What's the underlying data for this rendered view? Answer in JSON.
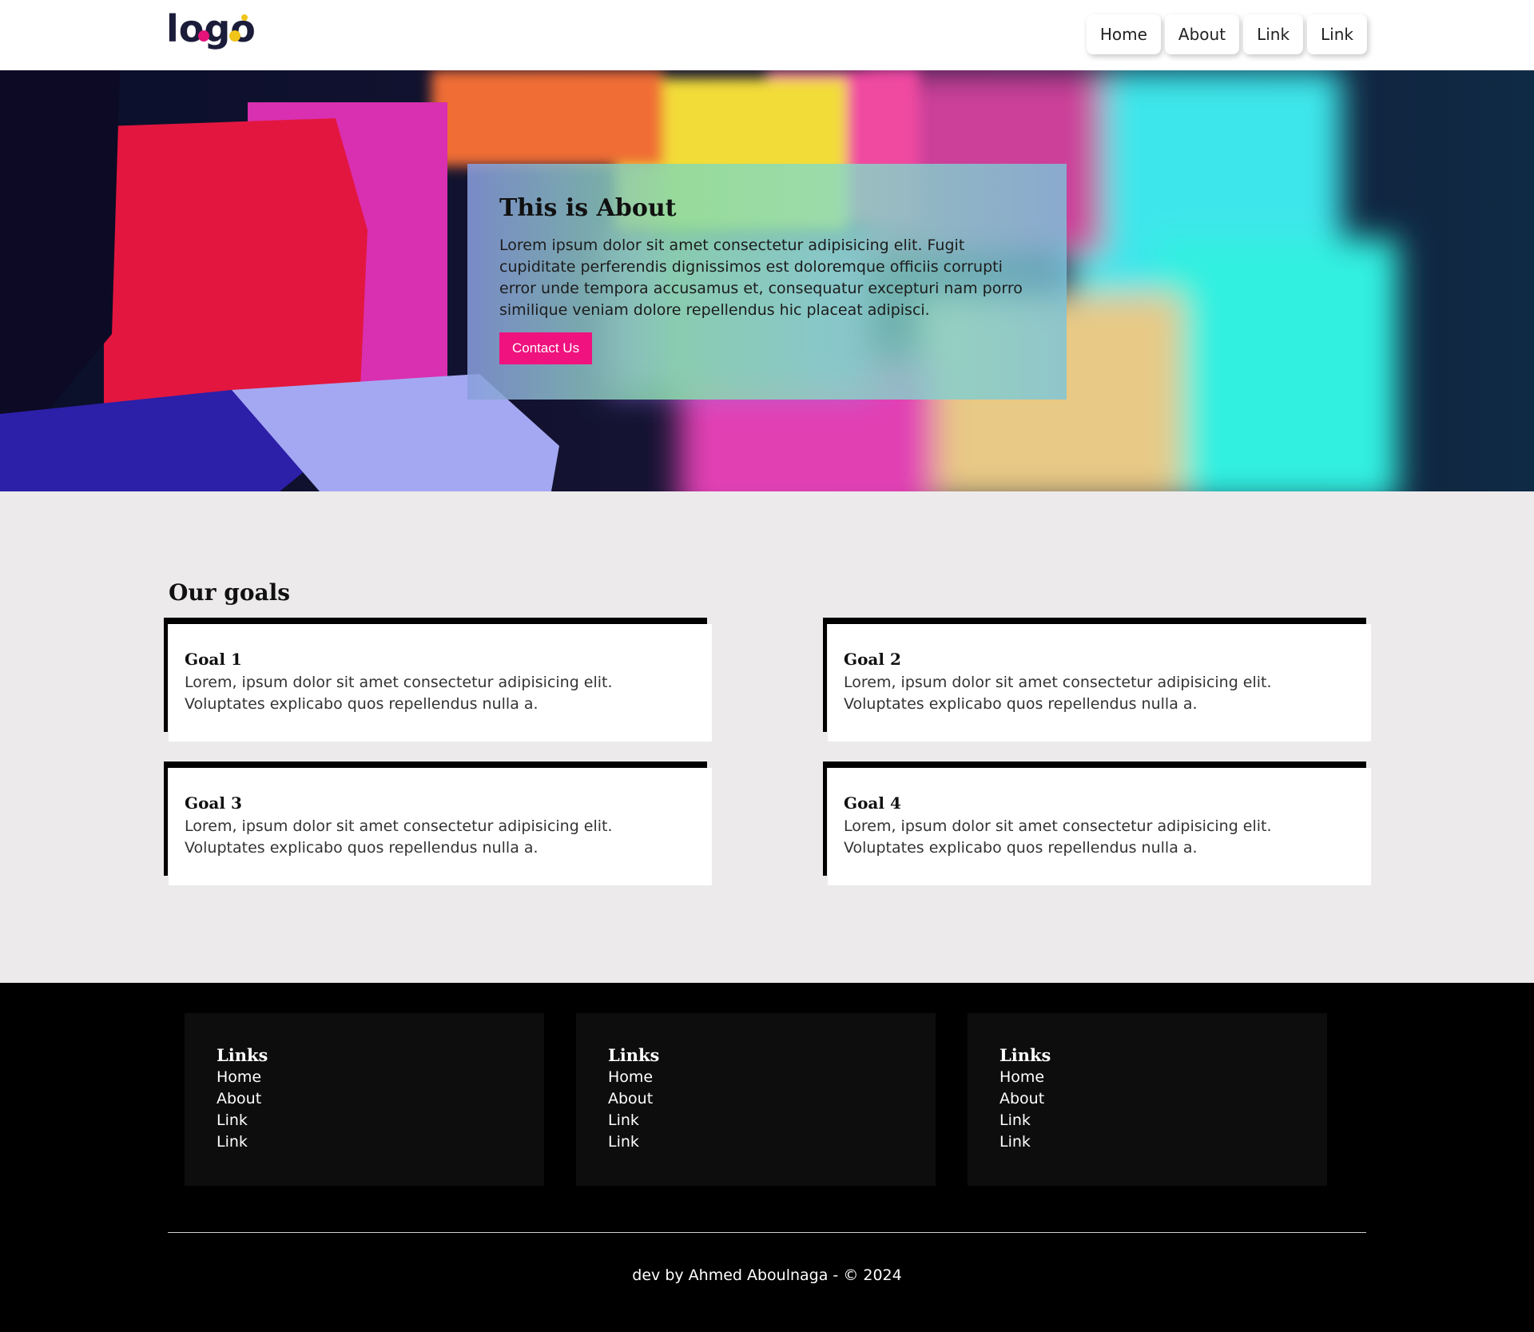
{
  "header": {
    "logo_text": "logo",
    "nav": [
      "Home",
      "About",
      "Link",
      "Link"
    ]
  },
  "hero": {
    "title": "This is About",
    "text": "Lorem ipsum dolor sit amet consectetur adipisicing elit. Fugit cupiditate perferendis dignissimos est doloremque officiis corrupti error unde tempora accusamus et, consequatur excepturi nam porro similique veniam dolore repellendus hic placeat adipisci.",
    "button": "Contact Us"
  },
  "goals": {
    "title": "Our goals",
    "items": [
      {
        "title": "Goal 1",
        "text": "Lorem, ipsum dolor sit amet consectetur adipisicing elit. Voluptates explicabo quos repellendus nulla a."
      },
      {
        "title": "Goal 2",
        "text": "Lorem, ipsum dolor sit amet consectetur adipisicing elit. Voluptates explicabo quos repellendus nulla a."
      },
      {
        "title": "Goal 3",
        "text": "Lorem, ipsum dolor sit amet consectetur adipisicing elit. Voluptates explicabo quos repellendus nulla a."
      },
      {
        "title": "Goal 4",
        "text": "Lorem, ipsum dolor sit amet consectetur adipisicing elit. Voluptates explicabo quos repellendus nulla a."
      }
    ]
  },
  "footer": {
    "columns": [
      {
        "title": "Links",
        "links": [
          "Home",
          "About",
          "Link",
          "Link"
        ]
      },
      {
        "title": "Links",
        "links": [
          "Home",
          "About",
          "Link",
          "Link"
        ]
      },
      {
        "title": "Links",
        "links": [
          "Home",
          "About",
          "Link",
          "Link"
        ]
      }
    ],
    "copyright": "dev by Ahmed Aboulnaga - © 2024"
  },
  "colors": {
    "accent": "#f0127e",
    "footer_bg": "#000000",
    "goals_bg": "#eceaeb"
  }
}
